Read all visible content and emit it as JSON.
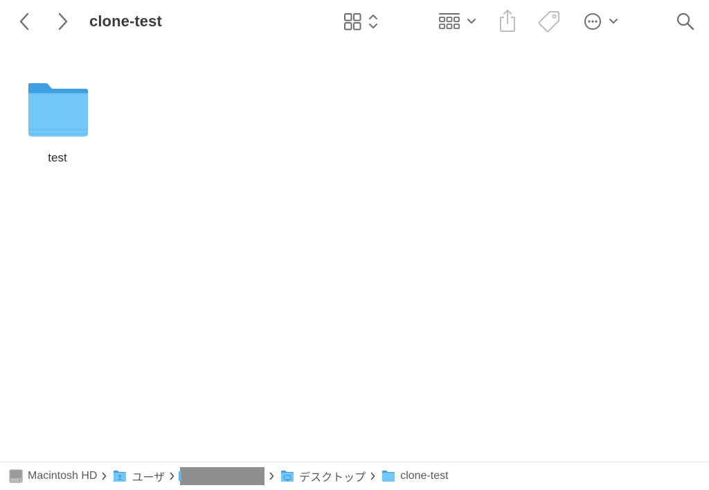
{
  "window": {
    "title": "clone-test"
  },
  "toolbar": {
    "back_icon": "chevron-left-icon",
    "forward_icon": "chevron-right-icon",
    "view_icon": "icon-grid-icon",
    "group_icon": "group-grid-icon",
    "share_icon": "share-icon",
    "tag_icon": "tag-icon",
    "more_icon": "ellipsis-circle-icon",
    "search_icon": "search-icon"
  },
  "content": {
    "items": [
      {
        "name": "test",
        "kind": "folder"
      }
    ]
  },
  "pathbar": {
    "crumbs": [
      {
        "label": "Macintosh HD",
        "icon": "hard-drive-icon"
      },
      {
        "label": "ユーザ",
        "icon": "users-folder-icon"
      },
      {
        "label": "",
        "icon": "home-folder-icon",
        "redacted": true
      },
      {
        "label": "デスクトップ",
        "icon": "desktop-folder-icon"
      },
      {
        "label": "clone-test",
        "icon": "folder-icon"
      }
    ]
  },
  "colors": {
    "folder_light": "#74c7fa",
    "folder_dark": "#3f9fe0",
    "icon_gray": "#6e6e6e",
    "icon_disabled": "#bdbdbd",
    "redaction": "#8e8e8e"
  }
}
